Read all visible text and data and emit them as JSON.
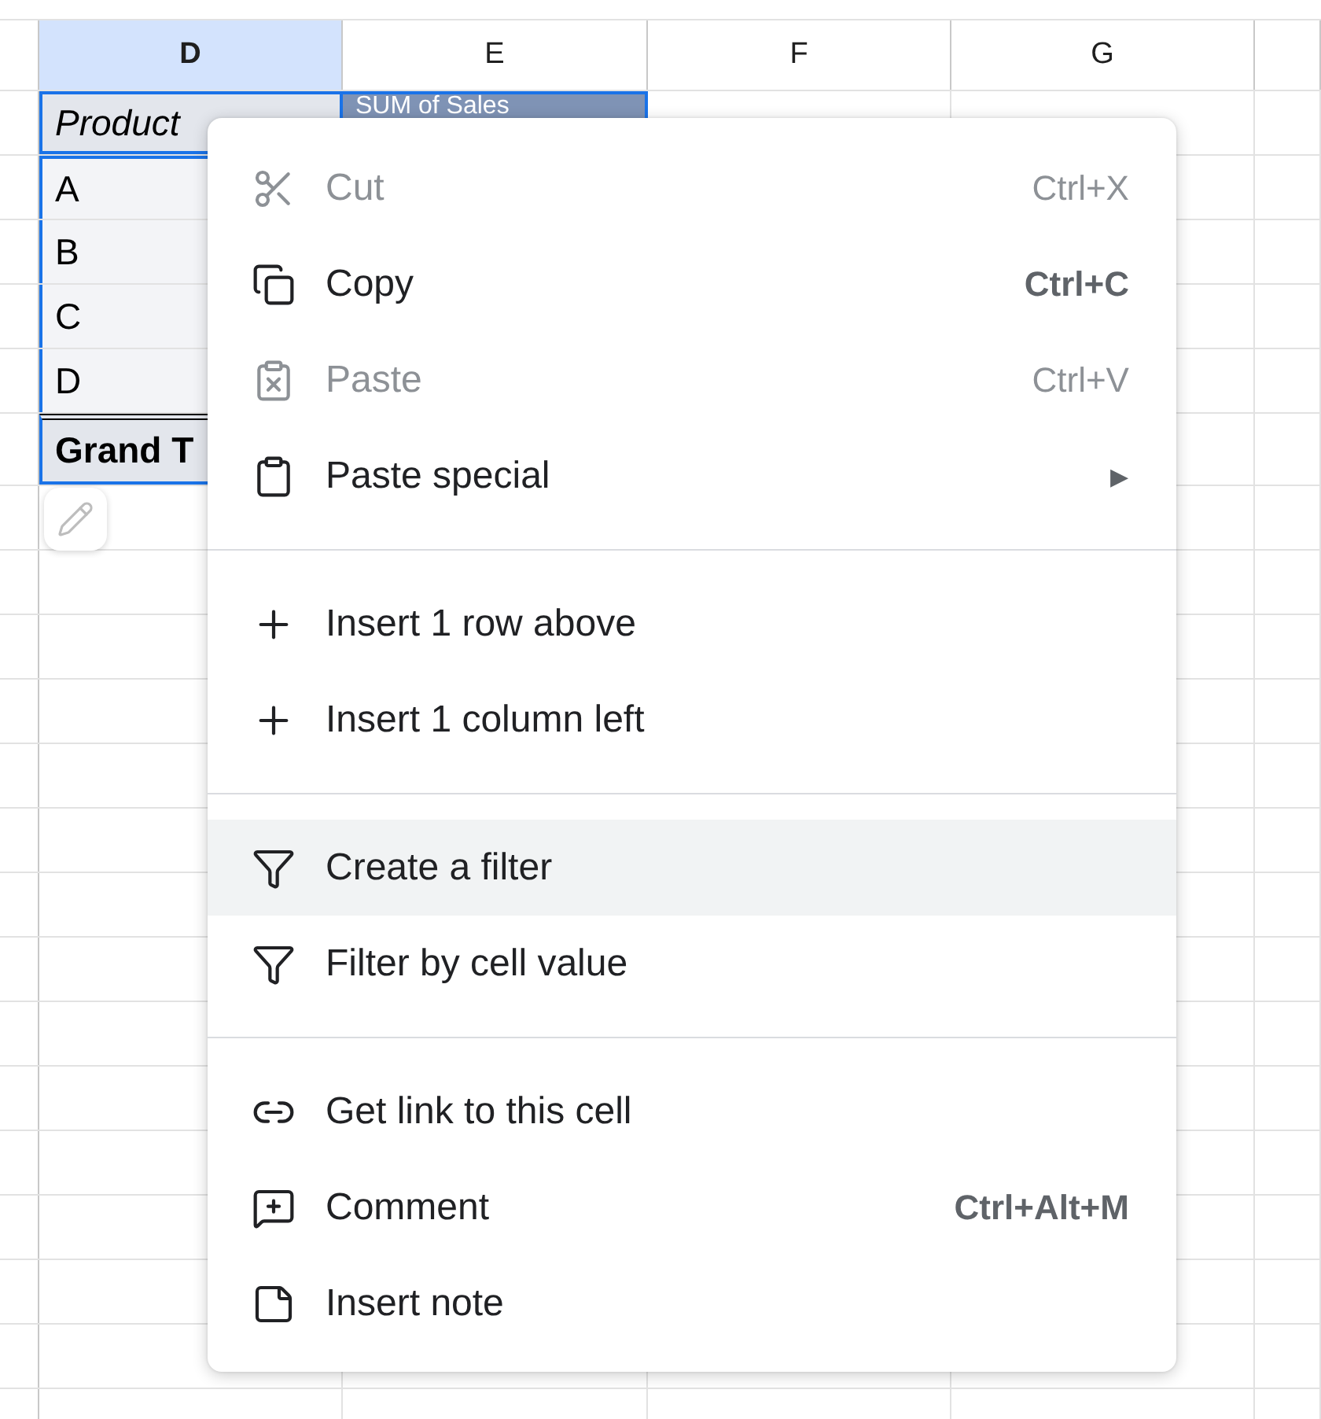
{
  "columns": [
    {
      "label": "D",
      "selected": true
    },
    {
      "label": "E",
      "selected": false
    },
    {
      "label": "F",
      "selected": false
    },
    {
      "label": "G",
      "selected": false
    }
  ],
  "pivot": {
    "row_header": "Product",
    "value_header": "SUM of Sales",
    "rows": [
      "A",
      "B",
      "C",
      "D"
    ],
    "total_label": "Grand T"
  },
  "menu": {
    "items": [
      {
        "kind": "item",
        "label": "Cut",
        "shortcut": "Ctrl+X",
        "disabled": true,
        "selected": false
      },
      {
        "kind": "item",
        "label": "Copy",
        "shortcut": "Ctrl+C",
        "disabled": false,
        "selected": false
      },
      {
        "kind": "item",
        "label": "Paste",
        "shortcut": "Ctrl+V",
        "disabled": true,
        "selected": false
      },
      {
        "kind": "item",
        "label": "Paste special",
        "submenu_arrow": "▶",
        "disabled": false,
        "selected": false
      },
      {
        "kind": "divider"
      },
      {
        "kind": "item",
        "label": "Insert 1 row above",
        "disabled": false,
        "selected": false
      },
      {
        "kind": "item",
        "label": "Insert 1 column left",
        "disabled": false,
        "selected": false
      },
      {
        "kind": "divider"
      },
      {
        "kind": "item",
        "label": "Create a filter",
        "disabled": false,
        "selected": true
      },
      {
        "kind": "item",
        "label": "Filter by cell value",
        "disabled": false,
        "selected": false
      },
      {
        "kind": "divider"
      },
      {
        "kind": "item",
        "label": "Get link to this cell",
        "disabled": false,
        "selected": false
      },
      {
        "kind": "item",
        "label": "Comment",
        "shortcut": "Ctrl+Alt+M",
        "disabled": false,
        "selected": false
      },
      {
        "kind": "item",
        "label": "Insert note",
        "disabled": false,
        "selected": false
      }
    ]
  }
}
